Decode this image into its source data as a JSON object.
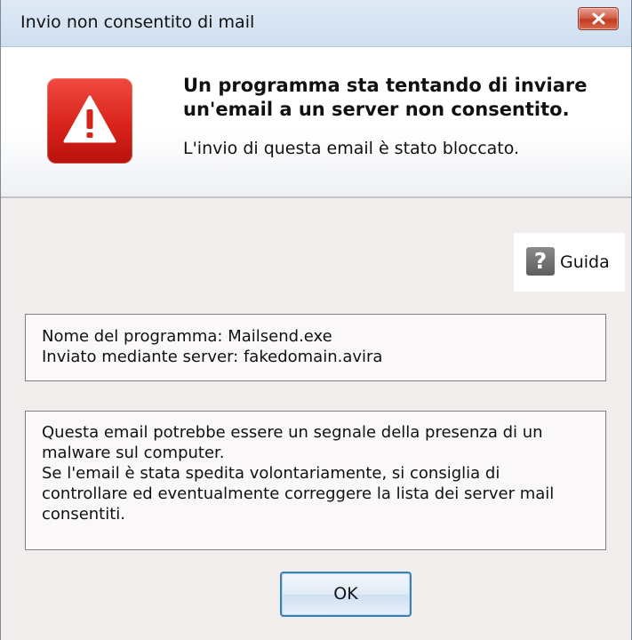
{
  "window": {
    "title": "Invio non consentito di mail"
  },
  "header": {
    "headline": "Un programma sta tentando di inviare un'email a un server non consentito.",
    "subline": "L'invio di questa email è stato bloccato.",
    "icon": "warning-icon",
    "accent_color": "#d8231b"
  },
  "help": {
    "icon": "question-icon",
    "icon_glyph": "?",
    "label": "Guida"
  },
  "details": {
    "program_line": "Nome del programma: Mailsend.exe",
    "server_line": "Inviato mediante server: fakedomain.avira"
  },
  "message": {
    "line1": "Questa email potrebbe essere un segnale della presenza di un malware sul computer.",
    "line2": "Se l'email è stata spedita volontariamente, si consiglia di controllare ed eventualmente correggere la lista dei server mail consentiti."
  },
  "buttons": {
    "ok_label": "OK"
  }
}
